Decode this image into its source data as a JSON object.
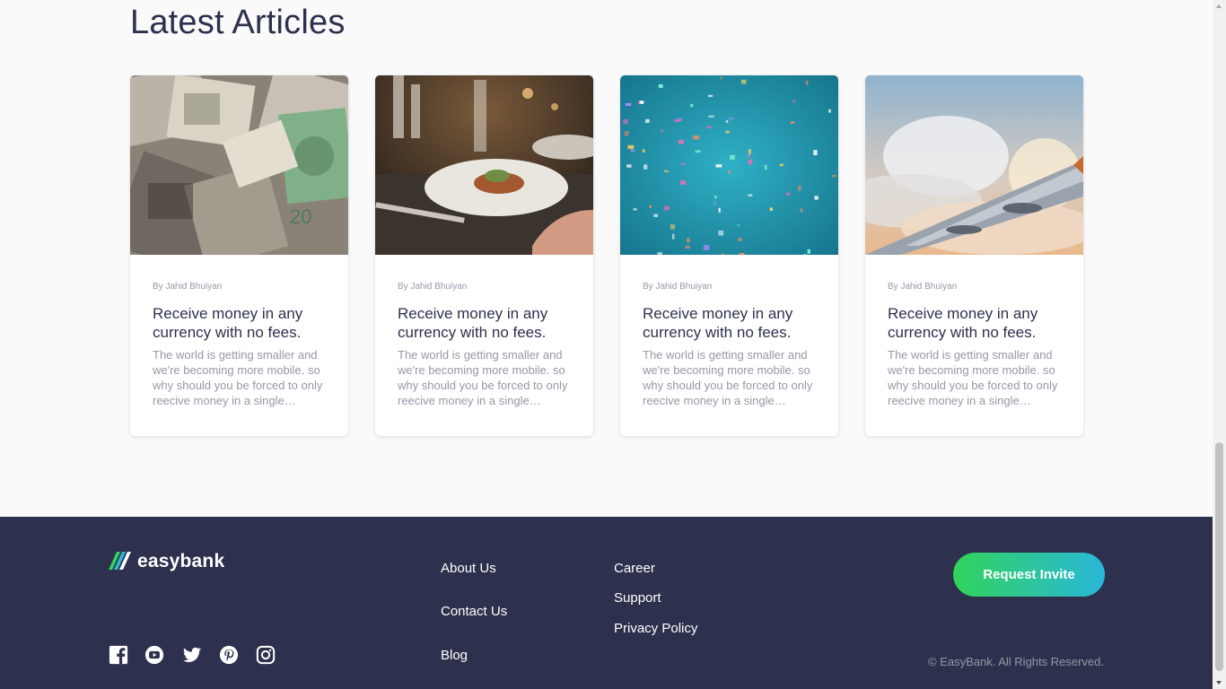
{
  "section": {
    "title": "Latest Articles"
  },
  "articles": [
    {
      "author": "By Jahid Bhuiyan",
      "title": "Receive money in any currency with no fees.",
      "excerpt": "The world is getting smaller and we're becoming more mobile. so why should you be forced to only reecive money in a single currency?",
      "image": "currency-notes-photo"
    },
    {
      "author": "By Jahid Bhuiyan",
      "title": "Receive money in any currency with no fees.",
      "excerpt": "The world is getting smaller and we're becoming more mobile. so why should you be forced to only reecive money in a single currency?",
      "image": "restaurant-dinner-photo"
    },
    {
      "author": "By Jahid Bhuiyan",
      "title": "Receive money in any currency with no fees.",
      "excerpt": "The world is getting smaller and we're becoming more mobile. so why should you be forced to only reecive money in a single currency?",
      "image": "confetti-photo"
    },
    {
      "author": "By Jahid Bhuiyan",
      "title": "Receive money in any currency with no fees.",
      "excerpt": "The world is getting smaller and we're becoming more mobile. so why should you be forced to only reecive money in a single currency?",
      "image": "airplane-wing-photo"
    }
  ],
  "footer": {
    "logo_text": "easybank",
    "social_icons": [
      "facebook-icon",
      "youtube-icon",
      "twitter-icon",
      "pinterest-icon",
      "instagram-icon"
    ],
    "links_col1": [
      "About Us",
      "Contact Us",
      "Blog"
    ],
    "links_col2": [
      "Career",
      "Support",
      "Privacy Policy"
    ],
    "cta_label": "Request Invite",
    "copyright": "© EasyBank. All Rights Reserved."
  },
  "colors": {
    "primary_text": "#2d314d",
    "muted_text": "#9698a6",
    "footer_bg": "#2d314d",
    "gradient_start": "#31d35c",
    "gradient_end": "#2bb7da",
    "page_bg": "#fafafa"
  }
}
